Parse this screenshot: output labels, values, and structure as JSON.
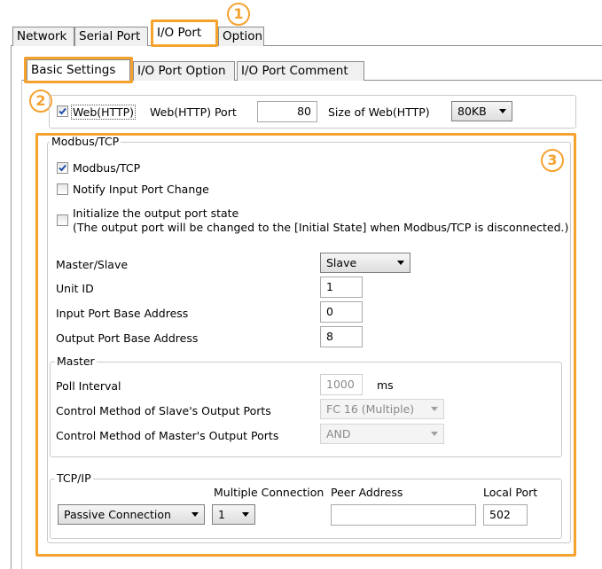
{
  "tabs_top": [
    "Network",
    "Serial Port",
    "I/O Port",
    "Option"
  ],
  "tabs_sub": [
    "Basic Settings",
    "I/O Port Option",
    "I/O Port Comment"
  ],
  "badges": [
    "1",
    "2",
    "3"
  ],
  "web": {
    "checkbox_label": "Web(HTTP)",
    "checked": true,
    "port_label": "Web(HTTP) Port",
    "port_value": "80",
    "size_label": "Size of Web(HTTP)",
    "size_value": "80KB"
  },
  "modbus": {
    "legend": "Modbus/TCP",
    "enable_label": "Modbus/TCP",
    "enable_checked": true,
    "notify_label": "Notify Input Port Change",
    "notify_checked": false,
    "init_label_1": "Initialize the output port state",
    "init_label_2": "(The output port will be changed to the [Initial State] when Modbus/TCP is disconnected.)",
    "init_checked": false,
    "master_slave_label": "Master/Slave",
    "master_slave_value": "Slave",
    "unit_id_label": "Unit ID",
    "unit_id_value": "1",
    "input_base_label": "Input Port Base Address",
    "input_base_value": "0",
    "output_base_label": "Output Port Base Address",
    "output_base_value": "8"
  },
  "master": {
    "legend": "Master",
    "poll_label": "Poll Interval",
    "poll_value": "1000",
    "poll_unit": "ms",
    "slave_method_label": "Control Method of Slave's Output Ports",
    "slave_method_value": "FC 16 (Multiple)",
    "master_method_label": "Control Method of Master's Output Ports",
    "master_method_value": "AND"
  },
  "tcpip": {
    "legend": "TCP/IP",
    "multi_label": "Multiple Connection",
    "peer_label": "Peer Address",
    "local_label": "Local Port",
    "connection_value": "Passive Connection",
    "multi_value": "1",
    "peer_value": "",
    "local_value": "502"
  },
  "colors": {
    "highlight": "#f5a22f",
    "frame": "#c9c9c9",
    "tab_bg": "#f0f0f0"
  }
}
